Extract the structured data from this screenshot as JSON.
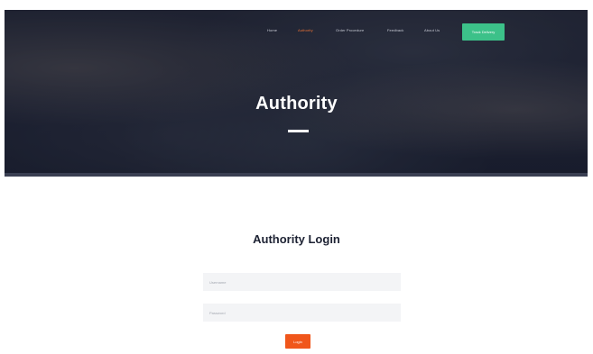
{
  "nav": {
    "items": [
      {
        "label": "Home",
        "active": false
      },
      {
        "label": "Authority",
        "active": true
      },
      {
        "label": "Order Procedure",
        "active": false
      },
      {
        "label": "Feedback",
        "active": false
      },
      {
        "label": "About Us",
        "active": false
      }
    ],
    "cta_label": "Track Delivery"
  },
  "hero": {
    "title": "Authority"
  },
  "login": {
    "title": "Authority Login",
    "username_placeholder": "Username",
    "password_placeholder": "Password",
    "button_label": "Login"
  },
  "colors": {
    "accent_orange": "#f0561b",
    "cta_green": "#3cc189",
    "hero_dark": "#22263a",
    "active_nav": "#f07335"
  }
}
